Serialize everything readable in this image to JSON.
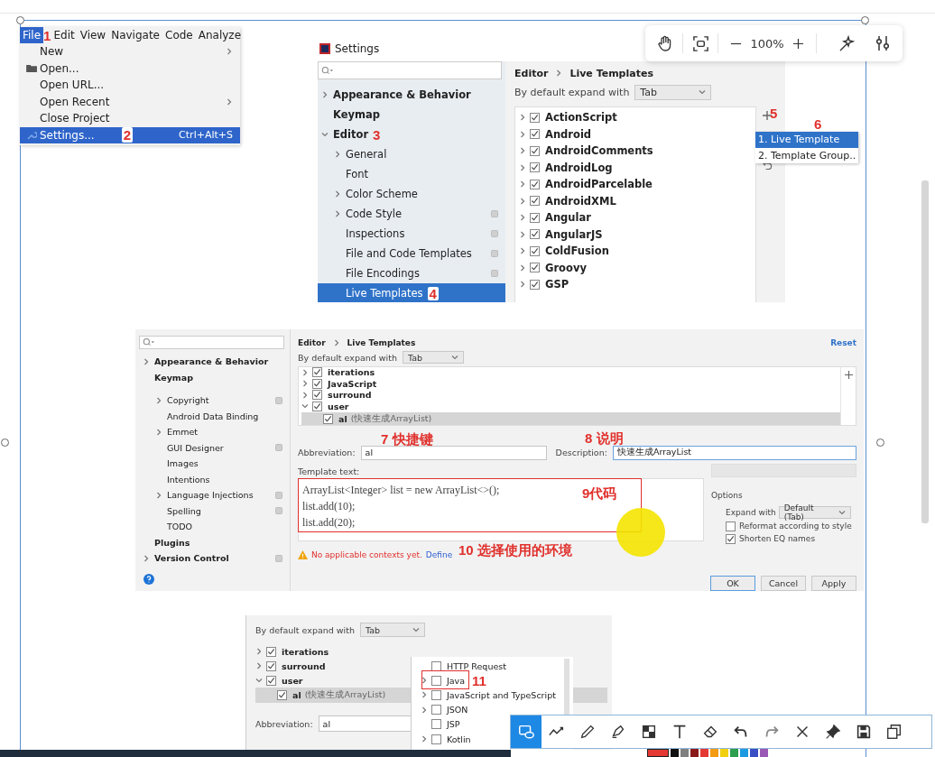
{
  "zoom_toolbar": {
    "zoom": "100%"
  },
  "file_menu": {
    "menubar": [
      {
        "label": "File",
        "selected": true,
        "note": "1"
      },
      {
        "label": "Edit",
        "selected": false
      },
      {
        "label": "View",
        "selected": false
      },
      {
        "label": "Navigate",
        "selected": false
      },
      {
        "label": "Code",
        "selected": false
      },
      {
        "label": "Analyze",
        "selected": false
      }
    ],
    "items": [
      {
        "kind": "submenu",
        "label": "New",
        "selected": false
      },
      {
        "kind": "folder",
        "label": "Open...",
        "selected": false
      },
      {
        "kind": "plain",
        "label": "Open URL...",
        "selected": false
      },
      {
        "kind": "submenu",
        "label": "Open Recent",
        "selected": false
      },
      {
        "kind": "plain",
        "label": "Close Project",
        "selected": false
      },
      {
        "kind": "wrench",
        "label": "Settings...",
        "shortcut": "Ctrl+Alt+S",
        "selected": true,
        "note": "2"
      }
    ]
  },
  "settings_dialog": {
    "title": "Settings",
    "tree": [
      {
        "label": "Appearance & Behavior",
        "kind": "group",
        "expanded": false,
        "selected": false,
        "scoped": false
      },
      {
        "label": "Keymap",
        "kind": "leaf",
        "selected": false,
        "scoped": false
      },
      {
        "label": "Editor",
        "kind": "group",
        "expanded": true,
        "selected": false,
        "scoped": false,
        "note": "3",
        "children": [
          {
            "label": "General",
            "kind": "group",
            "expanded": false,
            "selected": false,
            "scoped": false
          },
          {
            "label": "Font",
            "kind": "leaf",
            "selected": false,
            "scoped": false
          },
          {
            "label": "Color Scheme",
            "kind": "group",
            "expanded": false,
            "selected": false,
            "scoped": false
          },
          {
            "label": "Code Style",
            "kind": "group",
            "expanded": false,
            "selected": false,
            "scoped": true
          },
          {
            "label": "Inspections",
            "kind": "leaf",
            "selected": false,
            "scoped": true
          },
          {
            "label": "File and Code Templates",
            "kind": "leaf",
            "selected": false,
            "scoped": true
          },
          {
            "label": "File Encodings",
            "kind": "leaf",
            "selected": false,
            "scoped": true
          },
          {
            "label": "Live Templates",
            "kind": "leaf",
            "selected": true,
            "scoped": false,
            "note": "4"
          }
        ]
      }
    ],
    "breadcrumb": [
      "Editor",
      "Live Templates"
    ],
    "expand_with": {
      "label": "By default expand with",
      "value": "Tab"
    },
    "groups": [
      {
        "label": "ActionScript",
        "checked": true,
        "expanded": false
      },
      {
        "label": "Android",
        "checked": true,
        "expanded": false
      },
      {
        "label": "AndroidComments",
        "checked": true,
        "expanded": false
      },
      {
        "label": "AndroidLog",
        "checked": true,
        "expanded": false
      },
      {
        "label": "AndroidParcelable",
        "checked": true,
        "expanded": false
      },
      {
        "label": "AndroidXML",
        "checked": true,
        "expanded": false
      },
      {
        "label": "Angular",
        "checked": true,
        "expanded": false
      },
      {
        "label": "AngularJS",
        "checked": true,
        "expanded": false
      },
      {
        "label": "ColdFusion",
        "checked": true,
        "expanded": false
      },
      {
        "label": "Groovy",
        "checked": true,
        "expanded": false
      },
      {
        "label": "GSP",
        "checked": true,
        "expanded": false
      }
    ],
    "add_note": "5",
    "add_menu": {
      "note": "6",
      "items": [
        {
          "label": "1. Live Template",
          "selected": true
        },
        {
          "label": "2. Template Group..",
          "selected": false
        }
      ]
    }
  },
  "template_editor": {
    "tree": [
      {
        "label": "Appearance & Behavior",
        "kind": "group",
        "expanded": false,
        "selected": false,
        "scoped": false
      },
      {
        "label": "Keymap",
        "kind": "leaf",
        "selected": false,
        "scoped": false
      },
      {
        "children": [
          {
            "label": "Copyright",
            "kind": "group",
            "expanded": false,
            "selected": false,
            "scoped": true
          },
          {
            "label": "Android Data Binding",
            "kind": "leaf",
            "selected": false,
            "scoped": false
          },
          {
            "label": "Emmet",
            "kind": "group",
            "expanded": false,
            "selected": false,
            "scoped": false
          },
          {
            "label": "GUI Designer",
            "kind": "leaf",
            "selected": false,
            "scoped": true
          },
          {
            "label": "Images",
            "kind": "leaf",
            "selected": false,
            "scoped": false
          },
          {
            "label": "Intentions",
            "kind": "leaf",
            "selected": false,
            "scoped": false
          },
          {
            "label": "Language Injections",
            "kind": "group",
            "expanded": false,
            "selected": false,
            "scoped": true
          },
          {
            "label": "Spelling",
            "kind": "leaf",
            "selected": false,
            "scoped": true
          },
          {
            "label": "TODO",
            "kind": "leaf",
            "selected": false,
            "scoped": false
          }
        ]
      },
      {
        "label": "Plugins",
        "kind": "leaf",
        "selected": false,
        "scoped": false
      },
      {
        "label": "Version Control",
        "kind": "group",
        "expanded": false,
        "selected": false,
        "scoped": true
      }
    ],
    "breadcrumb": [
      "Editor",
      "Live Templates"
    ],
    "reset": "Reset",
    "expand_with": {
      "label": "By default expand with",
      "value": "Tab"
    },
    "templates": [
      {
        "label": "iterations",
        "checked": true,
        "expanded": false,
        "selected": false
      },
      {
        "label": "JavaScript",
        "checked": true,
        "expanded": false,
        "selected": false
      },
      {
        "label": "surround",
        "checked": true,
        "expanded": false,
        "selected": false
      },
      {
        "label": "user",
        "checked": true,
        "expanded": true,
        "selected": false,
        "children": [
          {
            "label": "al",
            "description": "(快速生成ArrayList)",
            "checked": true,
            "selected": true
          }
        ]
      }
    ],
    "abbreviation": {
      "label": "Abbreviation:",
      "value": "al",
      "note": "7 快捷键"
    },
    "description": {
      "label": "Description:",
      "value": "快速生成ArrayList",
      "note": "8 说明"
    },
    "template_text": {
      "label": "Template text:",
      "lines": [
        "ArrayList<Integer> list = new ArrayList<>();",
        "list.add(10);",
        "list.add(20);"
      ],
      "note": "9代码"
    },
    "edit_variables": {
      "disabled": true
    },
    "options": {
      "title": "Options",
      "expand_with": {
        "label": "Expand with",
        "value": "Default (Tab)"
      },
      "checkboxes": [
        {
          "label": "Reformat according to style",
          "checked": false
        },
        {
          "label": "Shorten EQ names",
          "checked": true
        }
      ]
    },
    "warning": {
      "text": "No applicable contexts yet.",
      "link": "Define",
      "note": "10 选择使用的环境"
    },
    "buttons": [
      {
        "label": "OK",
        "default": true
      },
      {
        "label": "Cancel",
        "default": false
      },
      {
        "label": "Apply",
        "default": false
      }
    ]
  },
  "context_step": {
    "expand_with": {
      "label": "By default expand with",
      "value": "Tab"
    },
    "templates": [
      {
        "label": "iterations",
        "checked": true,
        "expanded": false,
        "selected": false
      },
      {
        "label": "surround",
        "checked": true,
        "expanded": false,
        "selected": false
      },
      {
        "label": "user",
        "checked": true,
        "expanded": true,
        "selected": false,
        "children": [
          {
            "label": "al",
            "description": "(快速生成ArrayList)",
            "checked": true,
            "selected": true
          }
        ]
      }
    ],
    "abbreviation": {
      "label": "Abbreviation:",
      "value": "al"
    },
    "contexts": [
      {
        "label": "HTTP Request",
        "kind": "leaf",
        "checked": false
      },
      {
        "label": "Java",
        "kind": "group",
        "expanded": false,
        "checked": false,
        "note": "11"
      },
      {
        "label": "JavaScript and TypeScript",
        "kind": "group",
        "expanded": false,
        "checked": false
      },
      {
        "label": "JSON",
        "kind": "group",
        "expanded": false,
        "checked": false
      },
      {
        "label": "JSP",
        "kind": "leaf",
        "checked": false
      },
      {
        "label": "Kotlin",
        "kind": "group",
        "expanded": false,
        "checked": false
      }
    ]
  },
  "markup_toolbar": {
    "tools": [
      {
        "kind": "rectangle",
        "selected": true
      },
      {
        "kind": "polyline",
        "selected": false
      },
      {
        "kind": "pencil",
        "selected": false
      },
      {
        "kind": "highlighter",
        "selected": false
      },
      {
        "kind": "mosaic",
        "selected": false
      },
      {
        "kind": "text",
        "selected": false
      },
      {
        "kind": "eraser",
        "selected": false
      },
      {
        "kind": "undo",
        "selected": false
      },
      {
        "kind": "redo",
        "selected": false
      },
      {
        "kind": "close",
        "selected": false
      },
      {
        "kind": "pin",
        "selected": false
      },
      {
        "kind": "save",
        "selected": false
      },
      {
        "kind": "copy",
        "selected": false
      }
    ],
    "palette": [
      {
        "color": "#e53935",
        "selected": true
      },
      {
        "color": "#111111",
        "selected": false
      },
      {
        "color": "#808080",
        "selected": false
      },
      {
        "color": "#8b1a1a",
        "selected": false
      },
      {
        "color": "#e53935",
        "selected": false
      },
      {
        "color": "#f39c12",
        "selected": false
      },
      {
        "color": "#f1d10f",
        "selected": false
      },
      {
        "color": "#2e9e4f",
        "selected": false
      },
      {
        "color": "#1e9be0",
        "selected": false
      },
      {
        "color": "#3a4fc4",
        "selected": false
      },
      {
        "color": "#9b59b6",
        "selected": false
      }
    ]
  }
}
